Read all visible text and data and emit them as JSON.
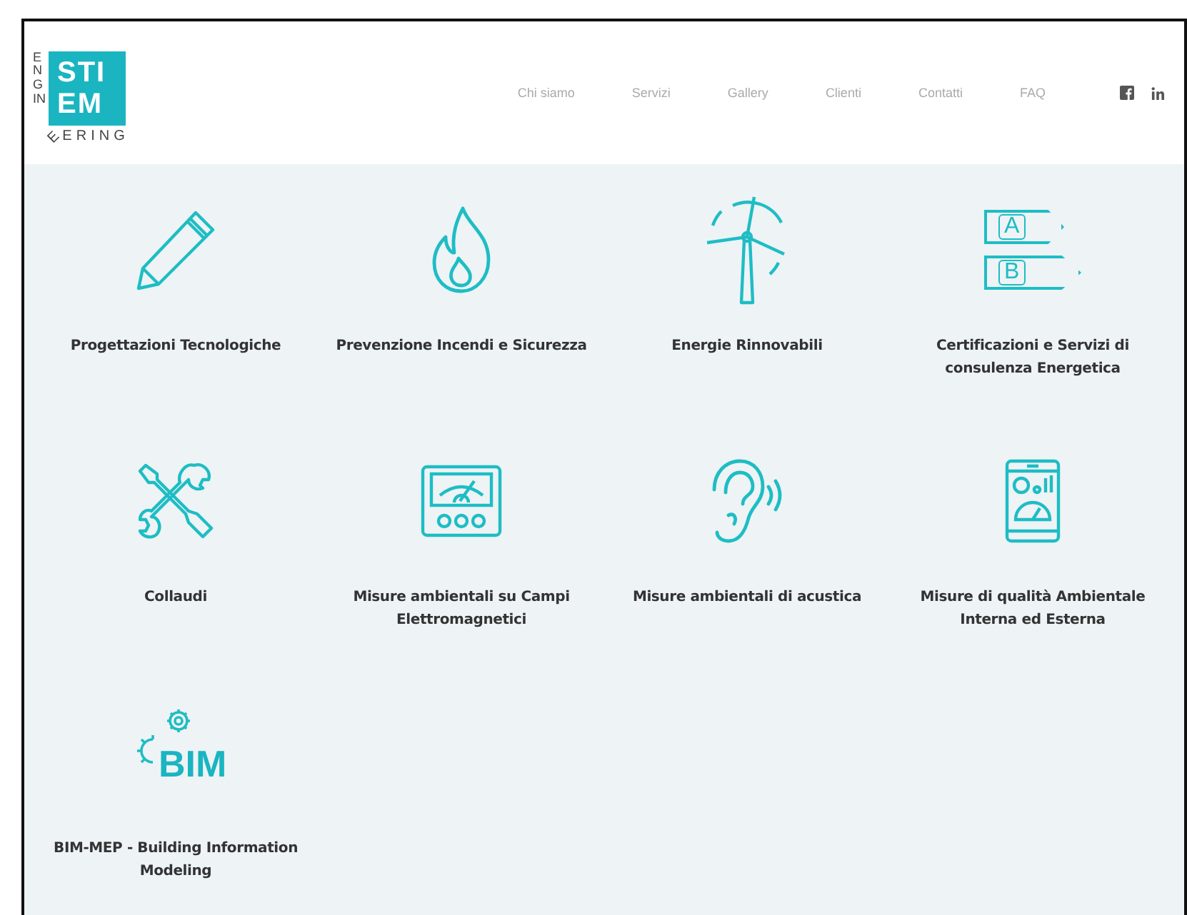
{
  "logo": {
    "box_lines": [
      "STI",
      "EM"
    ],
    "side": "ENGIN",
    "corner": "E",
    "bottom": "ERING"
  },
  "nav": [
    {
      "label": "Chi siamo"
    },
    {
      "label": "Servizi"
    },
    {
      "label": "Gallery"
    },
    {
      "label": "Clienti"
    },
    {
      "label": "Contatti"
    },
    {
      "label": "FAQ"
    }
  ],
  "social": [
    {
      "kind": "facebook"
    },
    {
      "kind": "linkedin"
    }
  ],
  "services": [
    {
      "kind": "pencil",
      "label": "Progettazioni Tecnologiche"
    },
    {
      "kind": "flame",
      "label": "Prevenzione Incendi e Sicurezza"
    },
    {
      "kind": "turbine",
      "label": "Energie Rinnovabili"
    },
    {
      "kind": "energy-class",
      "label": "Certificazioni e Servizi di consulenza Energetica",
      "icon_text": [
        "A",
        "B"
      ]
    },
    {
      "kind": "tools",
      "label": "Collaudi"
    },
    {
      "kind": "meter",
      "label": "Misure ambientali su Campi Elettromagnetici"
    },
    {
      "kind": "ear",
      "label": "Misure ambientali di acustica"
    },
    {
      "kind": "tablet",
      "label": "Misure di qualità Ambientale Interna ed Esterna"
    },
    {
      "kind": "bim",
      "label": "BIM-MEP - Building Information Modeling",
      "icon_text": [
        "BIM"
      ]
    }
  ]
}
